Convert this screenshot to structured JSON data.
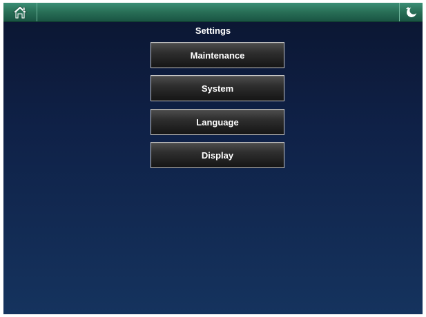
{
  "topbar": {
    "home_icon": "home-icon",
    "power_icon": "standby-power-icon"
  },
  "page": {
    "title": "Settings"
  },
  "menu": {
    "items": [
      {
        "label": "Maintenance"
      },
      {
        "label": "System"
      },
      {
        "label": "Language"
      },
      {
        "label": "Display"
      }
    ]
  },
  "colors": {
    "topbar": "#2a7158",
    "background_top": "#0b1530",
    "background_bottom": "#15335e",
    "button_border": "#c8c8c8"
  }
}
